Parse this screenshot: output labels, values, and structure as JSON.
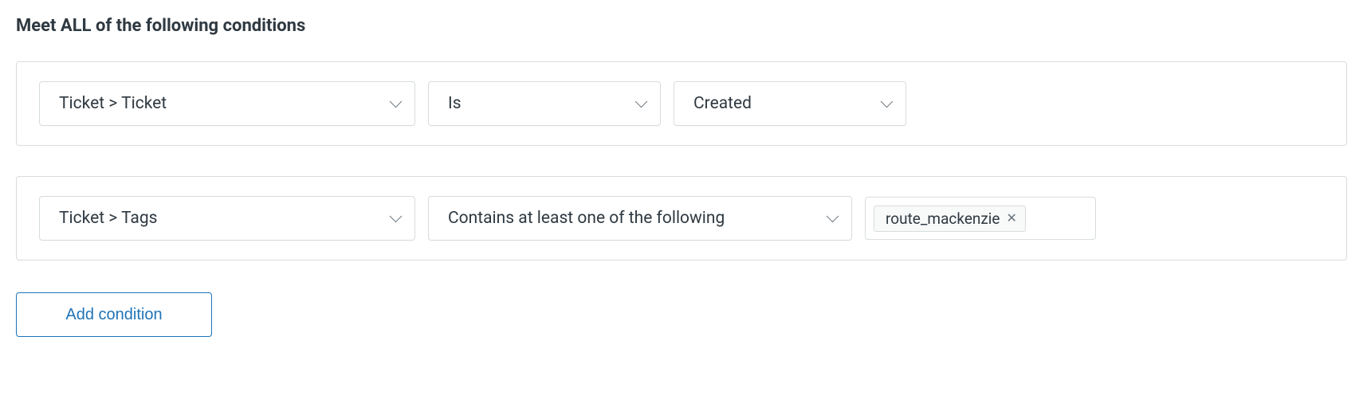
{
  "section_title": "Meet ALL of the following conditions",
  "conditions": [
    {
      "field": "Ticket > Ticket",
      "operator": "Is",
      "value": "Created"
    },
    {
      "field": "Ticket > Tags",
      "operator": "Contains at least one of the following",
      "tags": [
        "route_mackenzie"
      ]
    }
  ],
  "add_condition_label": "Add condition"
}
